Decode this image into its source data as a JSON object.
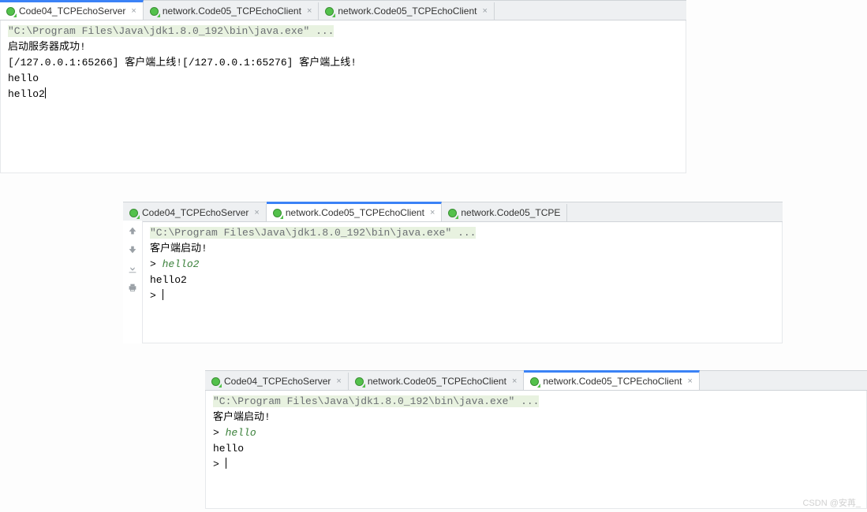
{
  "cmd": "\"C:\\Program Files\\Java\\jdk1.8.0_192\\bin\\java.exe\" ...",
  "tabs": {
    "server": "Code04_TCPEchoServer",
    "client": "network.Code05_TCPEchoClient",
    "client_short": "network.Code05_TCPE"
  },
  "pane1": {
    "lines": {
      "l1": "启动服务器成功!",
      "l2": "[/127.0.0.1:65266] 客户端上线![/127.0.0.1:65276] 客户端上线!",
      "l3": "hello",
      "l4": "hello2"
    }
  },
  "pane2": {
    "lines": {
      "l1": "客户端启动!",
      "l2_prefix": "> ",
      "l2_input": "hello2",
      "l3": "hello2",
      "l4": "> "
    }
  },
  "pane3": {
    "lines": {
      "l1": "客户端启动!",
      "l2_prefix": "> ",
      "l2_input": "hello",
      "l3": "hello",
      "l4": "> "
    }
  },
  "watermark": "CSDN @安苒_"
}
